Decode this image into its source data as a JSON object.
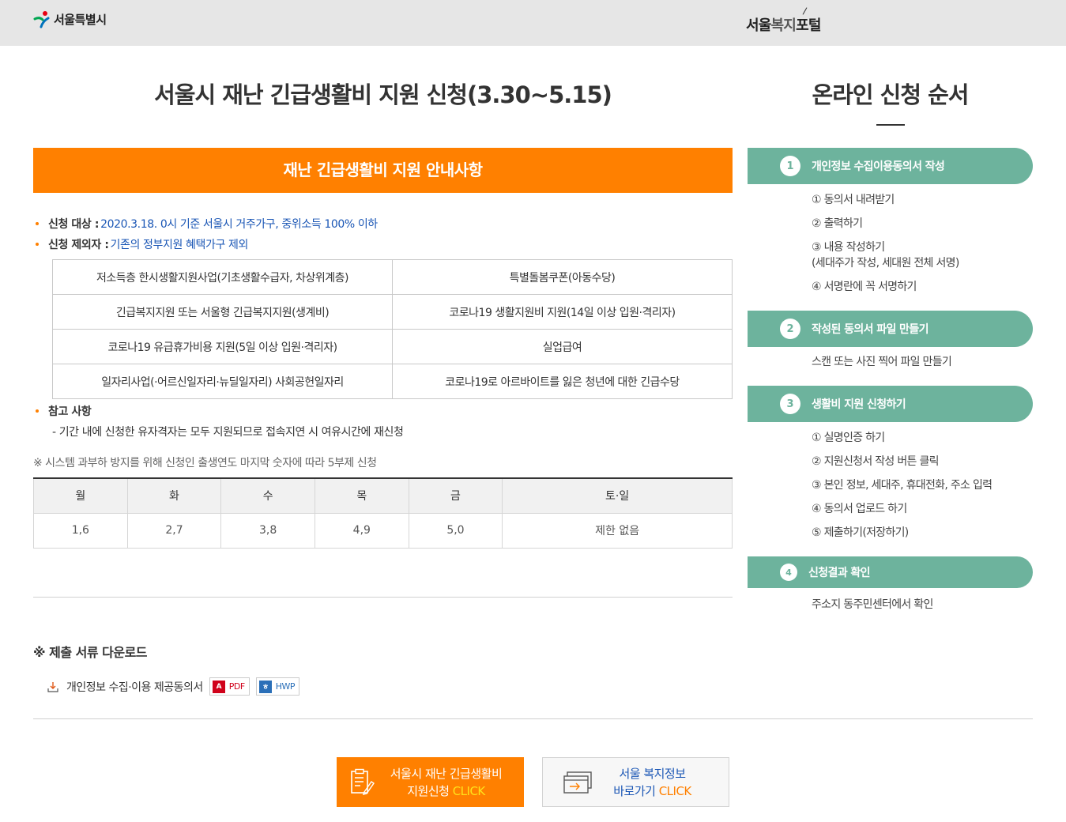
{
  "header": {
    "seoul_logo_text": "서울특별시",
    "portal_logo_main": "서울",
    "portal_logo_accent": "복지",
    "portal_logo_end": "포털"
  },
  "main": {
    "title": "서울시 재난 긴급생활비 지원 신청(3.30~5.15)",
    "banner": "재난 긴급생활비 지원 안내사항",
    "eligibility_label": "신청 대상 :",
    "eligibility_value": "2020.3.18. 0시 기준 서울시 거주가구, 중위소득 100% 이하",
    "exclusion_label": "신청 제외자 :",
    "exclusion_value": "기존의 정부지원 혜택가구 제외",
    "exclusion_table": [
      [
        "저소득층 한시생활지원사업(기초생활수급자, 차상위계층)",
        "특별돌봄쿠폰(아동수당)"
      ],
      [
        "긴급복지지원 또는 서울형 긴급복지지원(생계비)",
        "코로나19 생활지원비 지원(14일 이상 입원·격리자)"
      ],
      [
        "코로나19 유급휴가비용 지원(5일 이상 입원·격리자)",
        "실업급여"
      ],
      [
        "일자리사업(·어르신일자리·뉴딜일자리) 사회공헌일자리",
        "코로나19로 아르바이트를 잃은 청년에 대한 긴급수당"
      ]
    ],
    "note_label": "참고 사항",
    "note_text": "- 기간 내에 신청한 유자격자는 모두 지원되므로 접속지연 시 여유시간에 재신청",
    "system_note": "※ 시스템 과부하 방지를 위해 신청인 출생연도 마지막 숫자에 따라 5부제 신청",
    "day_headers": [
      "월",
      "화",
      "수",
      "목",
      "금",
      "토·일"
    ],
    "day_values": [
      "1,6",
      "2,7",
      "3,8",
      "4,9",
      "5,0",
      "제한 없음"
    ],
    "download_title": "※ 제출 서류 다운로드",
    "download_item": "개인정보 수집·이용 제공동의서",
    "pdf_label": "PDF",
    "hwp_label": "HWP",
    "cta_apply_line1": "서울시 재난 긴급생활비",
    "cta_apply_line2": "지원신청",
    "cta_apply_click": "CLICK",
    "cta_portal_line1": "서울 복지정보",
    "cta_portal_line2": "바로가기",
    "cta_portal_click": "CLICK"
  },
  "sidebar": {
    "title": "온라인 신청 순서",
    "steps": [
      {
        "num": "1",
        "label": "개인정보 수집이용동의서 작성",
        "items": [
          "① 동의서 내려받기",
          "② 출력하기",
          "③ 내용 작성하기",
          "(세대주가 작성, 세대원 전체 서명)",
          "④ 서명란에 꼭 서명하기"
        ]
      },
      {
        "num": "2",
        "label": "작성된 동의서 파일 만들기",
        "items": [
          "스캔 또는 사진 찍어 파일 만들기"
        ]
      },
      {
        "num": "3",
        "label": "생활비 지원 신청하기",
        "items": [
          "① 실명인증 하기",
          "② 지원신청서 작성 버튼 클릭",
          "③ 본인 정보, 세대주, 휴대전화, 주소 입력",
          "④ 동의서 업로드 하기",
          "⑤ 제출하기(저장하기)"
        ]
      },
      {
        "num": "4",
        "label": "신청결과 확인",
        "items": [
          "주소지 동주민센터에서 확인"
        ]
      }
    ]
  },
  "colors": {
    "accent_orange": "#ff8000",
    "step_green": "#6db39d",
    "link_blue": "#1a56b5"
  }
}
